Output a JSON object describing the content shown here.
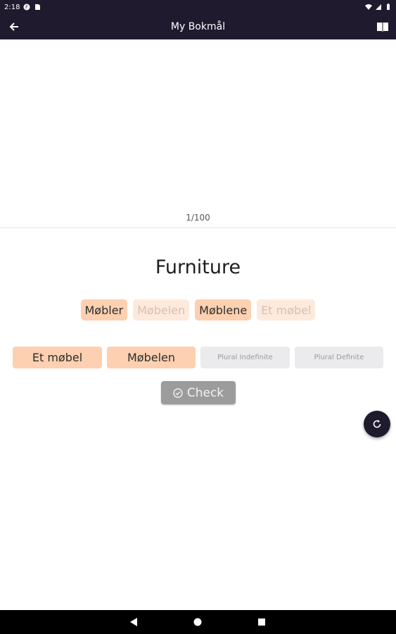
{
  "status_bar": {
    "time": "2:18",
    "icons": [
      "app-notification-icon",
      "sd-card-icon",
      "wifi-icon",
      "signal-icon",
      "battery-icon"
    ]
  },
  "app_bar": {
    "title": "My Bokmål",
    "left_icon": "back-arrow-icon",
    "right_icon": "book-icon"
  },
  "card": {
    "counter": "1/100"
  },
  "quiz": {
    "word": "Furniture",
    "choices": [
      {
        "label": "Møbler",
        "used": false
      },
      {
        "label": "Møbelen",
        "used": true
      },
      {
        "label": "Møblene",
        "used": false
      },
      {
        "label": "Et møbel",
        "used": true
      }
    ],
    "slots": [
      {
        "label": "Et møbel",
        "filled": true
      },
      {
        "label": "Møbelen",
        "filled": true
      },
      {
        "label": "Plural Indefinite",
        "filled": false
      },
      {
        "label": "Plural Definite",
        "filled": false
      }
    ],
    "check_label": "Check"
  },
  "fab": {
    "icon": "refresh-icon"
  },
  "nav_bar": {
    "icons": [
      "back-triangle-icon",
      "home-circle-icon",
      "recents-square-icon"
    ]
  },
  "colors": {
    "bar": "#1f1a2e",
    "chip_strong": "#fcd0b0",
    "chip_faded": "#fdeadc",
    "slot_empty": "#ebebed",
    "check_button": "#9c9c9c"
  }
}
